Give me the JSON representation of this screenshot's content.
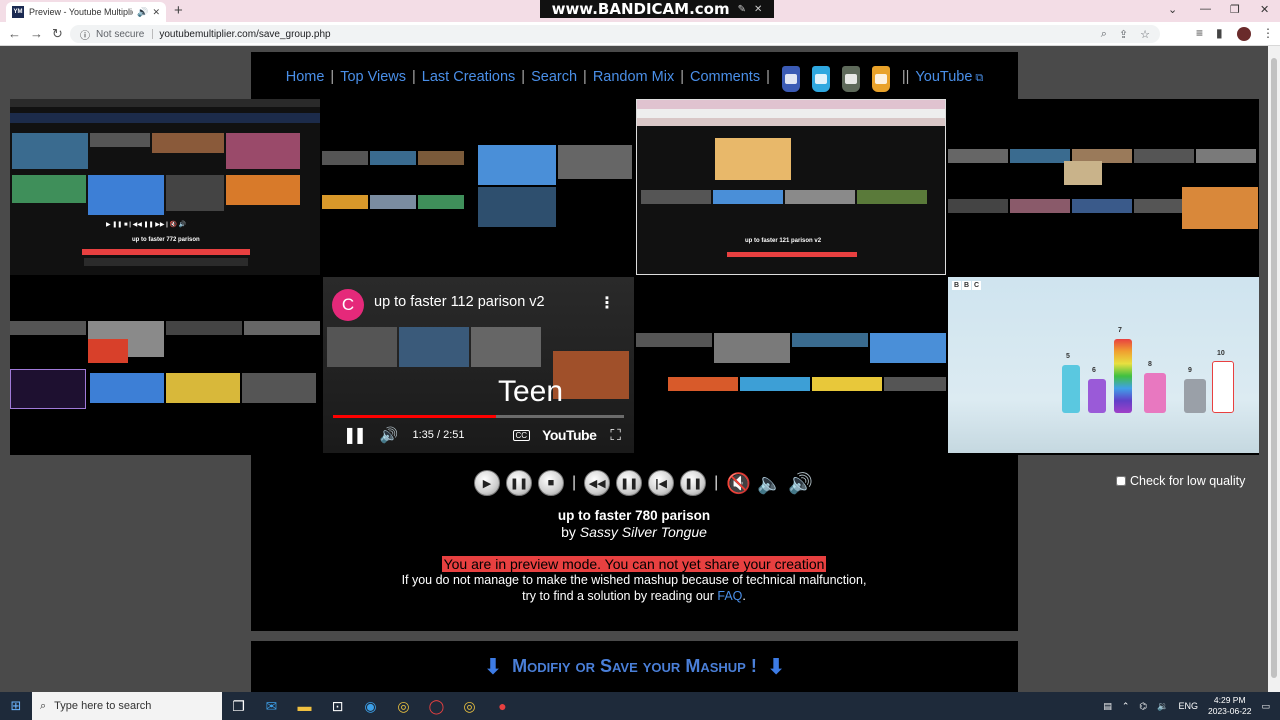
{
  "browser": {
    "tab_title": "Preview - Youtube Multiplier",
    "tab_favicon": "YM",
    "new_tab": "+",
    "recorder_watermark": "www.BANDICAM.com",
    "security_label": "Not secure",
    "url": "youtubemultiplier.com/save_group.php"
  },
  "nav": {
    "home": "Home",
    "top_views": "Top Views",
    "last_creations": "Last Creations",
    "search": "Search",
    "random_mix": "Random Mix",
    "comments": "Comments",
    "youtube": "YouTube",
    "share_icons": [
      "facebook-icon",
      "twitter-icon",
      "google-plus-icon",
      "rss-icon"
    ]
  },
  "player": {
    "channel_initial": "C",
    "video_title": "up to faster 112 parison v2",
    "caption_text": "Teen",
    "time": "1:35 / 2:51",
    "progress_fraction": 0.56,
    "brand": "YouTube"
  },
  "tiles": {
    "t1_caption": "up to faster 772 parison",
    "t3_caption": "up to faster 121 parison v2",
    "bbc_logo": [
      "B",
      "B",
      "C"
    ],
    "numberblocks": [
      "5",
      "6",
      "7",
      "8",
      "9",
      "10"
    ]
  },
  "mashup": {
    "title": "up to faster 780 parison",
    "by_prefix": "by",
    "author": "Sassy Silver Tongue",
    "low_quality_label": "Check for low quality",
    "low_quality_checked": false
  },
  "notice": {
    "warning": "You are in preview mode. You can not yet share your creation",
    "help_line1": "If you do not manage to make the wished mashup because of technical malfunction,",
    "help_line2_prefix": "try to find a solution by reading our",
    "faq_link": "FAQ",
    "help_line2_suffix": "."
  },
  "modify": {
    "label": "Modifiy or Save your Mashup !"
  },
  "taskbar": {
    "search_placeholder": "Type here to search",
    "language": "ENG",
    "time": "4:29 PM",
    "date": "2023-06-22"
  },
  "colors": {
    "link_blue": "#4a8fe8",
    "warning_red": "#e84040",
    "page_gray": "#4a4a4a"
  }
}
